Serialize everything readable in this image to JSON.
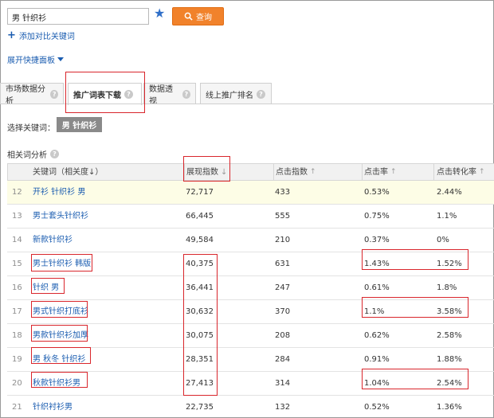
{
  "search": {
    "value": "男 针织衫",
    "button_label": "查询"
  },
  "add_compare_label": "添加对比关键词",
  "expand_panel_label": "展开快捷面板",
  "tabs": [
    {
      "label": "市场数据分析"
    },
    {
      "label": "推广词表下载"
    },
    {
      "label": "数据透视"
    },
    {
      "label": "线上推广排名"
    }
  ],
  "selector": {
    "label": "选择关键词：",
    "chip": "男 针织衫"
  },
  "section_title": "相关词分析",
  "table": {
    "headers": [
      "关键词（相关度↓）",
      "展现指数",
      "点击指数",
      "点击率",
      "点击转化率"
    ],
    "rows": [
      {
        "idx": "12",
        "keyword": "开衫 针织衫 男",
        "impressions": "72,717",
        "clicks": "433",
        "ctr": "0.53%",
        "cvr": "2.44%"
      },
      {
        "idx": "13",
        "keyword": "男士套头针织衫",
        "impressions": "66,445",
        "clicks": "555",
        "ctr": "0.75%",
        "cvr": "1.1%"
      },
      {
        "idx": "14",
        "keyword": "新款针织衫",
        "impressions": "49,584",
        "clicks": "210",
        "ctr": "0.37%",
        "cvr": "0%"
      },
      {
        "idx": "15",
        "keyword": "男士针织衫 韩版",
        "impressions": "40,375",
        "clicks": "631",
        "ctr": "1.43%",
        "cvr": "1.52%"
      },
      {
        "idx": "16",
        "keyword": "针织 男",
        "impressions": "36,441",
        "clicks": "247",
        "ctr": "0.61%",
        "cvr": "1.8%"
      },
      {
        "idx": "17",
        "keyword": "男式针织打底衫",
        "impressions": "30,632",
        "clicks": "370",
        "ctr": "1.1%",
        "cvr": "3.58%"
      },
      {
        "idx": "18",
        "keyword": "男款针织衫加厚",
        "impressions": "30,075",
        "clicks": "208",
        "ctr": "0.62%",
        "cvr": "2.58%"
      },
      {
        "idx": "19",
        "keyword": "男 秋冬 针织衫",
        "impressions": "28,351",
        "clicks": "284",
        "ctr": "0.91%",
        "cvr": "1.88%"
      },
      {
        "idx": "20",
        "keyword": "秋款针织衫男",
        "impressions": "27,413",
        "clicks": "314",
        "ctr": "1.04%",
        "cvr": "2.54%"
      },
      {
        "idx": "21",
        "keyword": "针织衬衫男",
        "impressions": "22,735",
        "clicks": "132",
        "ctr": "0.52%",
        "cvr": "1.36%"
      }
    ]
  },
  "colors": {
    "link": "#1a5cb0",
    "button": "#f1822b",
    "highlight_box": "#d9262c",
    "row_highlight": "#fdfde6"
  }
}
